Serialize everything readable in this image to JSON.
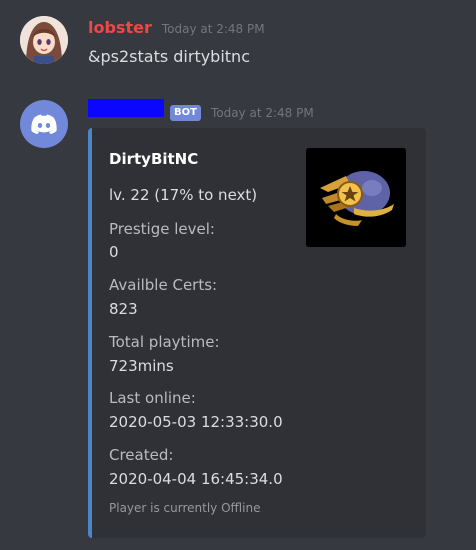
{
  "messages": [
    {
      "author": "lobster",
      "timestamp": "Today at 2:48 PM",
      "text": "&ps2stats dirtybitnc"
    },
    {
      "author_badge": "BOT",
      "timestamp": "Today at 2:48 PM",
      "embed": {
        "title": "DirtyBitNC",
        "level_line": "lv. 22 (17% to next)",
        "fields": [
          {
            "label": "Prestige level:",
            "value": "0"
          },
          {
            "label": "Availble Certs:",
            "value": "823"
          },
          {
            "label": "Total playtime:",
            "value": "723mins"
          },
          {
            "label": "Last online:",
            "value": "2020-05-03 12:33:30.0"
          },
          {
            "label": "Created:",
            "value": "2020-04-04 16:45:34.0"
          }
        ],
        "footer": "Player is currently Offline",
        "accent_color": "#4c86c6"
      }
    }
  ],
  "colors": {
    "background": "#36393f",
    "embed_bg": "#2f3136",
    "username_red": "#f04747",
    "bot_badge": "#7289da",
    "timestamp": "#72767d"
  },
  "icons": {
    "bot_avatar": "discord-logo-icon",
    "user_avatar": "anime-girl-avatar",
    "thumbnail": "emblem-icon"
  }
}
